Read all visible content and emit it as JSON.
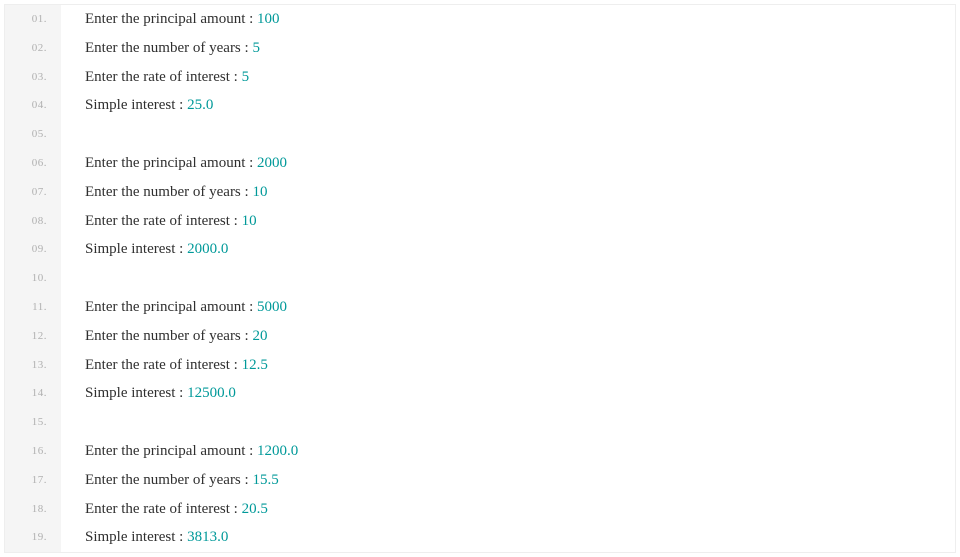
{
  "lines": [
    {
      "no": "01.",
      "tokens": [
        {
          "t": "Enter the principal amount : ",
          "c": "plain"
        },
        {
          "t": "100",
          "c": "num"
        }
      ]
    },
    {
      "no": "02.",
      "tokens": [
        {
          "t": "Enter the number of years : ",
          "c": "plain"
        },
        {
          "t": "5",
          "c": "num"
        }
      ]
    },
    {
      "no": "03.",
      "tokens": [
        {
          "t": "Enter the rate of interest : ",
          "c": "plain"
        },
        {
          "t": "5",
          "c": "num"
        }
      ]
    },
    {
      "no": "04.",
      "tokens": [
        {
          "t": "Simple interest : ",
          "c": "plain"
        },
        {
          "t": "25.0",
          "c": "num"
        }
      ]
    },
    {
      "no": "05.",
      "tokens": [
        {
          "t": " ",
          "c": "plain"
        }
      ]
    },
    {
      "no": "06.",
      "tokens": [
        {
          "t": "Enter the principal amount : ",
          "c": "plain"
        },
        {
          "t": "2000",
          "c": "num"
        }
      ]
    },
    {
      "no": "07.",
      "tokens": [
        {
          "t": "Enter the number of years : ",
          "c": "plain"
        },
        {
          "t": "10",
          "c": "num"
        }
      ]
    },
    {
      "no": "08.",
      "tokens": [
        {
          "t": "Enter the rate of interest : ",
          "c": "plain"
        },
        {
          "t": "10",
          "c": "num"
        }
      ]
    },
    {
      "no": "09.",
      "tokens": [
        {
          "t": "Simple interest : ",
          "c": "plain"
        },
        {
          "t": "2000.0",
          "c": "num"
        }
      ]
    },
    {
      "no": "10.",
      "tokens": [
        {
          "t": " ",
          "c": "plain"
        }
      ]
    },
    {
      "no": "11.",
      "tokens": [
        {
          "t": "Enter the principal amount : ",
          "c": "plain"
        },
        {
          "t": "5000",
          "c": "num"
        }
      ]
    },
    {
      "no": "12.",
      "tokens": [
        {
          "t": "Enter the number of years : ",
          "c": "plain"
        },
        {
          "t": "20",
          "c": "num"
        }
      ]
    },
    {
      "no": "13.",
      "tokens": [
        {
          "t": "Enter the rate of interest : ",
          "c": "plain"
        },
        {
          "t": "12.5",
          "c": "num"
        }
      ]
    },
    {
      "no": "14.",
      "tokens": [
        {
          "t": "Simple interest : ",
          "c": "plain"
        },
        {
          "t": "12500.0",
          "c": "num"
        }
      ]
    },
    {
      "no": "15.",
      "tokens": [
        {
          "t": " ",
          "c": "plain"
        }
      ]
    },
    {
      "no": "16.",
      "tokens": [
        {
          "t": "Enter the principal amount : ",
          "c": "plain"
        },
        {
          "t": "1200.0",
          "c": "num"
        }
      ]
    },
    {
      "no": "17.",
      "tokens": [
        {
          "t": "Enter the number of years : ",
          "c": "plain"
        },
        {
          "t": "15.5",
          "c": "num"
        }
      ]
    },
    {
      "no": "18.",
      "tokens": [
        {
          "t": "Enter the rate of interest : ",
          "c": "plain"
        },
        {
          "t": "20.5",
          "c": "num"
        }
      ]
    },
    {
      "no": "19.",
      "tokens": [
        {
          "t": "Simple interest : ",
          "c": "plain"
        },
        {
          "t": "3813.0",
          "c": "num"
        }
      ]
    }
  ]
}
